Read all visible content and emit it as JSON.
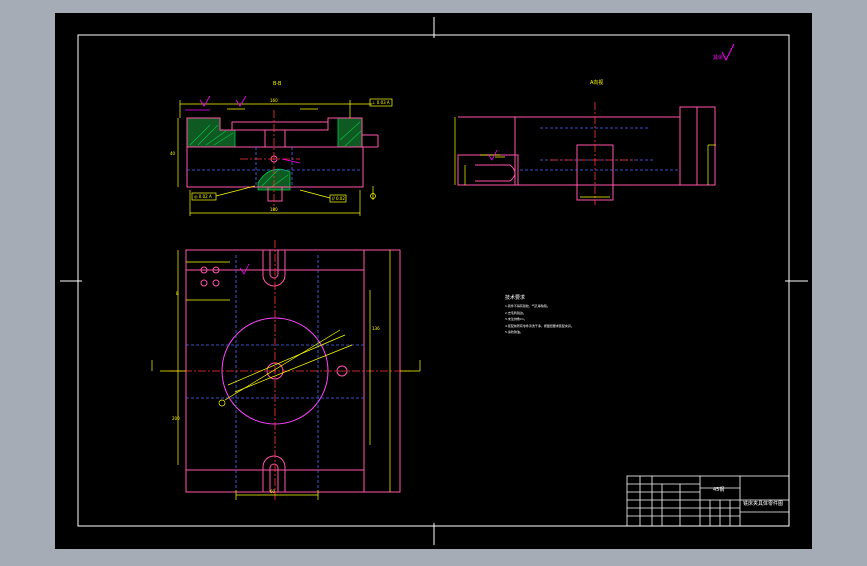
{
  "colors": {
    "viewport_bg": "#a6acb6",
    "sheet_bg": "#000000",
    "frame": "#ffffff",
    "outline": "#ff55aa",
    "dimension": "#ffff00",
    "centerline": "#ff3333",
    "hidden": "#4a6cff",
    "hatch": "#00cc44",
    "annotation": "#ff00ff",
    "text": "#ffffff"
  },
  "views": {
    "section_label": "B-B",
    "side_label": "A向视",
    "scale_note": "其余"
  },
  "technical_requirements": {
    "heading": "技术要求",
    "lines": [
      "1.铸件不得有裂纹、气孔等缺陷。",
      "2.去毛刺锐边。",
      "3.未注倒角C1。",
      "4.装配前所有零件清洗干净，按图纸要求装配夹具。",
      "5.涂防锈油。"
    ]
  },
  "title_block": {
    "material": "45钢",
    "drawing_title": "铣床夹具体零件图"
  }
}
